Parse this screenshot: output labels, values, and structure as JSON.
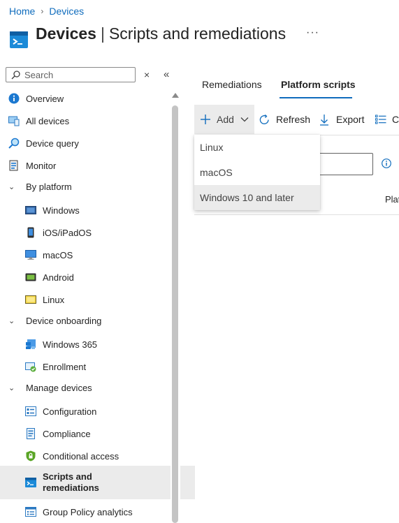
{
  "breadcrumb": {
    "home": "Home",
    "separator": "›",
    "devices": "Devices"
  },
  "header": {
    "title_bold": "Devices",
    "title_sep": "|",
    "title_rest": "Scripts and remediations",
    "more": "···",
    "icon": "scripts-blade-icon"
  },
  "search": {
    "placeholder": "Search",
    "clear": "×",
    "collapse": "«"
  },
  "nav": {
    "overview": "Overview",
    "all_devices": "All devices",
    "device_query": "Device query",
    "monitor": "Monitor",
    "by_platform": "By platform",
    "windows": "Windows",
    "ios": "iOS/iPadOS",
    "macos": "macOS",
    "android": "Android",
    "linux": "Linux",
    "device_onboarding": "Device onboarding",
    "windows365": "Windows 365",
    "enrollment": "Enrollment",
    "manage_devices": "Manage devices",
    "configuration": "Configuration",
    "compliance": "Compliance",
    "conditional_access": "Conditional access",
    "scripts_line1": "Scripts and",
    "scripts_line2": "remediations",
    "group_policy": "Group Policy analytics"
  },
  "tabs": {
    "remediations": "Remediations",
    "platform_scripts": "Platform scripts"
  },
  "toolbar": {
    "add": "Add",
    "refresh": "Refresh",
    "export": "Export",
    "columns": "Co"
  },
  "table": {
    "column_platform": "Platf"
  },
  "add_menu": {
    "items": [
      "Linux",
      "macOS",
      "Windows 10 and later"
    ]
  },
  "colors": {
    "accent": "#0f6cbd",
    "selected_bg": "#ebebeb"
  }
}
